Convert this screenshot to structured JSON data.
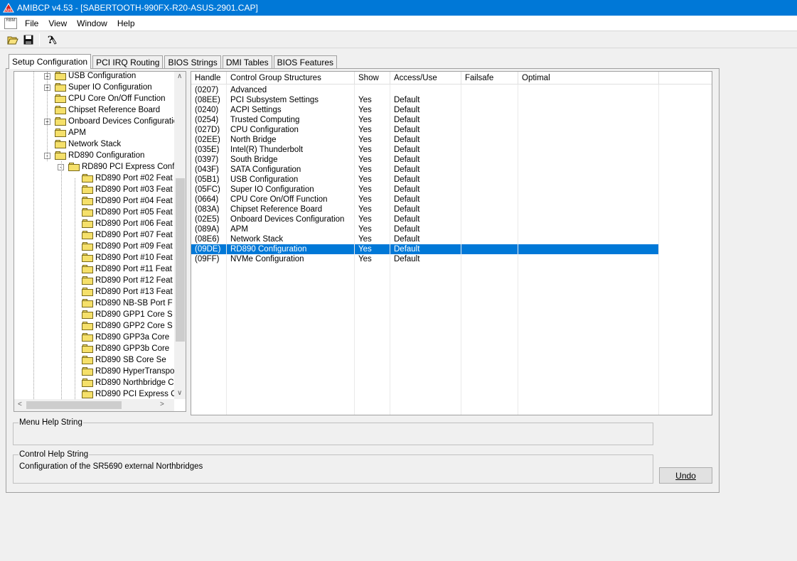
{
  "window": {
    "title": "AMIBCP v4.53 - [SABERTOOTH-990FX-R20-ASUS-2901.CAP]"
  },
  "menu": {
    "sys_icon_text": "RBM",
    "items": [
      "File",
      "View",
      "Window",
      "Help"
    ]
  },
  "toolbar": {
    "buttons": [
      "open-icon",
      "save-icon",
      "help-icon"
    ]
  },
  "tabs": [
    "Setup Configuration",
    "PCI IRQ Routing",
    "BIOS Strings",
    "DMI Tables",
    "BIOS Features"
  ],
  "active_tab": 0,
  "tree": {
    "items": [
      {
        "label": "USB Configuration",
        "expander": "+"
      },
      {
        "label": "Super IO Configuration",
        "expander": "+"
      },
      {
        "label": "CPU Core On/Off Function",
        "expander": ""
      },
      {
        "label": "Chipset Reference Board",
        "expander": ""
      },
      {
        "label": "Onboard Devices Configuratio",
        "expander": "+"
      },
      {
        "label": "APM",
        "expander": ""
      },
      {
        "label": "Network Stack",
        "expander": ""
      },
      {
        "label": "RD890 Configuration",
        "expander": "-"
      },
      {
        "label": "RD890 PCI Express Conf",
        "expander": "-"
      },
      {
        "label": "RD890 Port #02 Feat",
        "expander": ""
      },
      {
        "label": "RD890 Port #03 Feat",
        "expander": ""
      },
      {
        "label": "RD890 Port #04 Feat",
        "expander": ""
      },
      {
        "label": "RD890 Port #05 Feat",
        "expander": ""
      },
      {
        "label": "RD890 Port #06 Feat",
        "expander": ""
      },
      {
        "label": "RD890 Port #07 Feat",
        "expander": ""
      },
      {
        "label": "RD890 Port #09 Feat",
        "expander": ""
      },
      {
        "label": "RD890 Port #10 Feat",
        "expander": ""
      },
      {
        "label": "RD890 Port #11 Feat",
        "expander": ""
      },
      {
        "label": "RD890 Port #12 Feat",
        "expander": ""
      },
      {
        "label": "RD890 Port #13 Feat",
        "expander": ""
      },
      {
        "label": "RD890 NB-SB Port F",
        "expander": ""
      },
      {
        "label": "RD890 GPP1  Core S",
        "expander": ""
      },
      {
        "label": "RD890 GPP2  Core S",
        "expander": ""
      },
      {
        "label": "RD890 GPP3a Core",
        "expander": ""
      },
      {
        "label": "RD890 GPP3b Core",
        "expander": ""
      },
      {
        "label": "RD890 SB    Core Se",
        "expander": ""
      },
      {
        "label": "RD890 HyperTranspo",
        "expander": ""
      },
      {
        "label": "RD890 Northbridge C",
        "expander": ""
      },
      {
        "label": "RD890 PCI Express C",
        "expander": ""
      }
    ],
    "scroll_up": "∧",
    "scroll_down": "∨",
    "scroll_left": "<",
    "scroll_right": ">"
  },
  "grid": {
    "columns": [
      "Handle",
      "Control Group Structures",
      "Show",
      "Access/Use",
      "Failsafe",
      "Optimal"
    ],
    "rows": [
      [
        "(0207)",
        "Advanced",
        "",
        "",
        "",
        ""
      ],
      [
        "(08EE)",
        "PCI Subsystem Settings",
        "Yes",
        "Default",
        "",
        ""
      ],
      [
        "(0240)",
        "ACPI Settings",
        "Yes",
        "Default",
        "",
        ""
      ],
      [
        "(0254)",
        "Trusted Computing",
        "Yes",
        "Default",
        "",
        ""
      ],
      [
        "(027D)",
        "CPU Configuration",
        "Yes",
        "Default",
        "",
        ""
      ],
      [
        "(02EE)",
        "North Bridge",
        "Yes",
        "Default",
        "",
        ""
      ],
      [
        "(035E)",
        "Intel(R) Thunderbolt",
        "Yes",
        "Default",
        "",
        ""
      ],
      [
        "(0397)",
        "South Bridge",
        "Yes",
        "Default",
        "",
        ""
      ],
      [
        "(043F)",
        "SATA Configuration",
        "Yes",
        "Default",
        "",
        ""
      ],
      [
        "(05B1)",
        "USB Configuration",
        "Yes",
        "Default",
        "",
        ""
      ],
      [
        "(05FC)",
        "Super IO Configuration",
        "Yes",
        "Default",
        "",
        ""
      ],
      [
        "(0664)",
        "CPU Core On/Off Function",
        "Yes",
        "Default",
        "",
        ""
      ],
      [
        "(083A)",
        "Chipset Reference Board",
        "Yes",
        "Default",
        "",
        ""
      ],
      [
        "(02E5)",
        "Onboard Devices Configuration",
        "Yes",
        "Default",
        "",
        ""
      ],
      [
        "(089A)",
        "APM",
        "Yes",
        "Default",
        "",
        ""
      ],
      [
        "(08E6)",
        "Network Stack",
        "Yes",
        "Default",
        "",
        ""
      ],
      [
        "(09DE)",
        "RD890 Configuration",
        "Yes",
        "Default",
        "",
        ""
      ],
      [
        "(09FF)",
        "NVMe Configuration",
        "Yes",
        "Default",
        "",
        ""
      ]
    ],
    "selected_row": 16
  },
  "help": {
    "menu_legend": "Menu Help String",
    "menu_text": "",
    "control_legend": "Control Help String",
    "control_text": "Configuration of the SR5690 external Northbridges"
  },
  "buttons": {
    "undo": "Undo"
  },
  "colors": {
    "titlebar": "#0078d7",
    "selection": "#0078d7",
    "folder": "#f5e06a"
  }
}
